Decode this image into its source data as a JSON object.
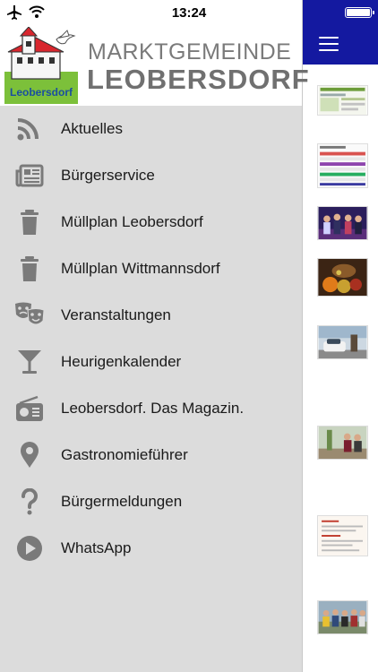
{
  "status_bar": {
    "time": "13:24"
  },
  "header": {
    "brand_line1": "MARKTGEMEINDE",
    "brand_line2": "LEOBERSDORF",
    "logo_text": "Leobersdorf"
  },
  "colors": {
    "topbar": "#1419a0",
    "drawer_bg": "#dcdcdc",
    "icon": "#7a7a7a",
    "logo_green": "#6ab42d",
    "logo_red": "#d8262e"
  },
  "menu": [
    {
      "label": "Aktuelles",
      "icon": "rss-icon"
    },
    {
      "label": "Bürgerservice",
      "icon": "newspaper-icon"
    },
    {
      "label": "Müllplan Leobersdorf",
      "icon": "trash-icon"
    },
    {
      "label": "Müllplan Wittmannsdorf",
      "icon": "trash-icon"
    },
    {
      "label": "Veranstaltungen",
      "icon": "theater-masks-icon"
    },
    {
      "label": "Heurigenkalender",
      "icon": "cocktail-glass-icon"
    },
    {
      "label": "Leobersdorf. Das Magazin.",
      "icon": "radio-icon"
    },
    {
      "label": "Gastronomieführer",
      "icon": "map-marker-icon"
    },
    {
      "label": "Bürgermeldungen",
      "icon": "question-mark-icon"
    },
    {
      "label": "WhatsApp",
      "icon": "play-circle-icon"
    }
  ],
  "content_thumbnails": [
    "news-thumbnail-1",
    "news-thumbnail-2",
    "news-thumbnail-3",
    "news-thumbnail-4",
    "news-thumbnail-5",
    "news-thumbnail-6",
    "news-thumbnail-7",
    "news-thumbnail-8"
  ]
}
